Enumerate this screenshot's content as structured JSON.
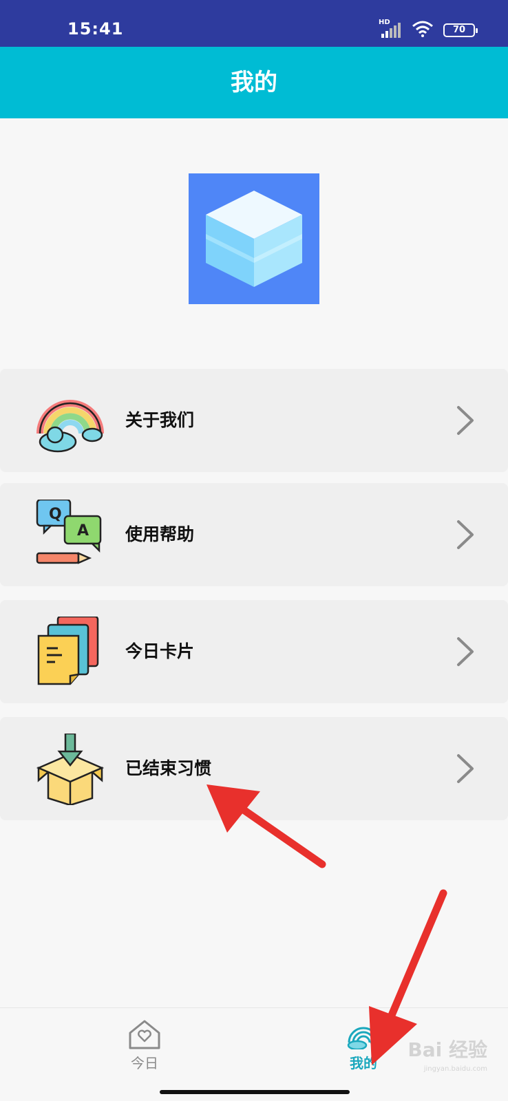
{
  "status_bar": {
    "time": "15:41",
    "network": "HD",
    "battery": "70"
  },
  "header": {
    "title": "我的"
  },
  "logo": {
    "icon": "cube-icon",
    "background_color": "#4f86f7"
  },
  "menu": {
    "items": [
      {
        "label": "关于我们",
        "icon": "rainbow-cloud-icon"
      },
      {
        "label": "使用帮助",
        "icon": "qa-chat-icon"
      },
      {
        "label": "今日卡片",
        "icon": "cards-icon"
      },
      {
        "label": "已结束习惯",
        "icon": "open-box-icon"
      }
    ]
  },
  "tab_bar": {
    "tabs": [
      {
        "label": "今日",
        "icon": "house-heart-icon",
        "active": false
      },
      {
        "label": "我的",
        "icon": "rainbow-cloud-icon",
        "active": true
      }
    ],
    "active_color": "#1ba8bd"
  },
  "watermark": {
    "text": "Bai 经验",
    "url_text": "jingyan.baidu.com"
  },
  "colors": {
    "status_bar": "#2e3b9e",
    "title_bar": "#00bcd4",
    "annotation_arrow": "#e8302c"
  }
}
